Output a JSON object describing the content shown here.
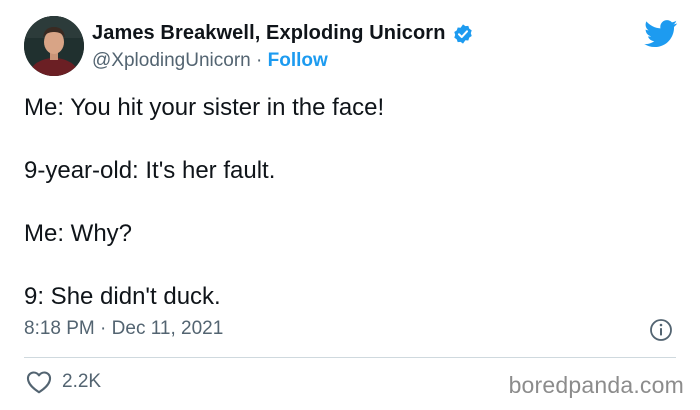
{
  "author": {
    "display_name": "James Breakwell, Exploding Unicorn",
    "handle": "@XplodingUnicorn",
    "separator": " · ",
    "follow_label": "Follow"
  },
  "tweet": {
    "lines": [
      "Me: You hit your sister in the face!",
      "9-year-old: It's her fault.",
      "Me: Why?",
      "9: She didn't duck."
    ],
    "time": "8:18 PM",
    "date_separator": " · ",
    "date": "Dec 11, 2021",
    "like_count": "2.2K"
  },
  "watermark": "boredpanda.com",
  "icons": {
    "verified": "verified-badge-icon",
    "brand": "twitter-bird-icon",
    "info": "info-icon",
    "like": "heart-icon"
  },
  "colors": {
    "accent": "#1d9bf0",
    "text": "#0f1419",
    "secondary_text": "#536471",
    "divider": "#cfd9de",
    "watermark": "#8c8c8c"
  }
}
